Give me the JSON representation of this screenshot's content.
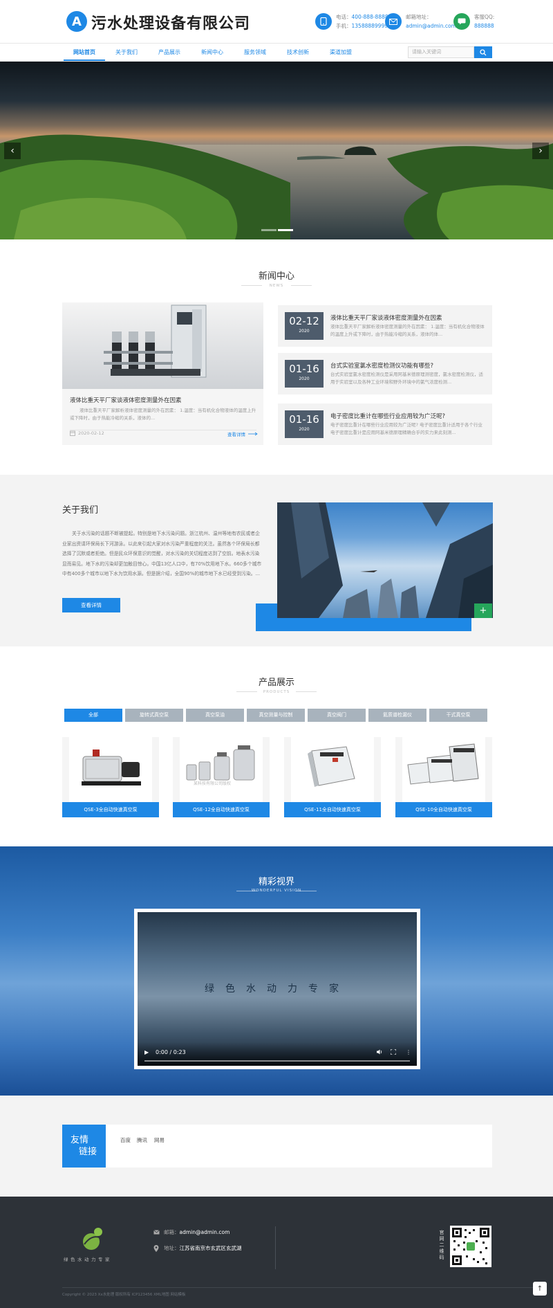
{
  "header": {
    "logo_letter": "A",
    "site_name": "污水处理设备有限公司",
    "phone_label": "电话：",
    "phone": "400-888-8888",
    "mobile_label": "手机：",
    "mobile": "13588889999",
    "email_label": "邮箱地址：",
    "email": "admin@admin.com",
    "qq_label": "客服QQ:",
    "qq": "888888"
  },
  "nav": {
    "items": [
      "网站首页",
      "关于我们",
      "产品展示",
      "新闻中心",
      "服务领域",
      "技术创新",
      "渠道加盟"
    ],
    "active": "网站首页",
    "search_placeholder": "请输入关键词"
  },
  "banner": {
    "slide_count": 2,
    "active_slide": 2
  },
  "news": {
    "title": "新闻中心",
    "subtitle": "NEWS",
    "feature": {
      "title": "液体比重天平厂家谈液体密度测量外在因素",
      "desc": "液体比重天平厂家解析液体密度测量的外在因素： 1.温度：当有机化合物液体的温度上升或下降时，由于热能冷缩的关系，液体的...",
      "date": "2020-02-12",
      "more": "查看详情"
    },
    "items": [
      {
        "day": "02-12",
        "year": "2020",
        "title": "液体比重天平厂家谈液体密度测量外在因素",
        "desc": "液体比重天平厂家解析液体密度测量的外在因素： 1.温度：当有机化合物液体的温度上升或下降时，由于热能冷缩的关系，液体的体..."
      },
      {
        "day": "01-16",
        "year": "2020",
        "title": "台式实验室氯水密度检测仪功能有哪些?",
        "desc": "台式实验室氯水密度检测仪是采用阿基米德原理测密度，氯水密度检测仪，适用于实验室以及各种工业环境和野外环境中的氯气浓度检测..."
      },
      {
        "day": "01-16",
        "year": "2020",
        "title": "电子密度比重计在哪些行业应用较为广泛呢?",
        "desc": "电子密度比重计在哪些行业应用较为广泛呢? 电子密度比重计适用于各个行业 电子密度比重计是应用阿基米德原理精确合乎的实力来此刻测..."
      }
    ]
  },
  "about": {
    "title": "关于我们",
    "text": "关于水污染的话题不断被提起。特别是地下水污染问题。浙江杭州、温州等地有农民或者企业家出资请环保局长下河游泳。以此来引起大家对水污染严重程度的关注。虽然各个环保局长都选择了沉默或者拒绝。但是民众环保意识的觉醒，对水污染的关切程度达到了空前。地表水污染显而易见。地下水的污染却更加触目惊心。中国13亿人口中，有70%饮用地下水。660多个城市中有400多个城市以地下水为饮用水源。但是据介绍，全国90%的城市地下水已经受到污染。...",
    "button": "查看详情",
    "plus": "+"
  },
  "products": {
    "title": "产品展示",
    "subtitle": "PRODUCTS",
    "tabs": [
      "全部",
      "旋转式真空泵",
      "真空泵油",
      "真空测量与控制",
      "真空阀门",
      "氦质谱检漏仪",
      "干式真空泵"
    ],
    "active_tab": "全部",
    "items": [
      {
        "name": "QSE-3全自动快速真空泵"
      },
      {
        "name": "QSE-12全自动快速真空泵",
        "watermark": "某科技有限公司版权"
      },
      {
        "name": "QSE-11全自动快速真空泵"
      },
      {
        "name": "QSE-10全自动快速真空泵"
      }
    ]
  },
  "video": {
    "title": "精彩视界",
    "subtitle": "WONDERFUL VISION",
    "slogan": "绿色水动力专家",
    "time": "0:00 / 0:23"
  },
  "links": {
    "badge_line1": "友情",
    "badge_line2": "链接",
    "items": [
      "百度",
      "腾讯",
      "网易"
    ]
  },
  "footer": {
    "logo_text": "绿色水动力专家",
    "email_label": "邮箱：",
    "email": "admin@admin.com",
    "address_label": "地址：",
    "address": "江苏省南京市玄武区玄武湖",
    "qr_label": "官网二维码",
    "copyright": "Copyright © 2023 Xx水处理 版权所有 ICP123456 XML地图 网站模板",
    "back_top": "↑"
  },
  "colors": {
    "primary": "#1e88e5",
    "green": "#26a65b",
    "footer_bg": "#2d3238",
    "date_box": "#4e5c6c"
  }
}
